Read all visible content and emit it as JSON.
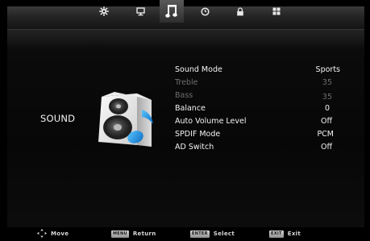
{
  "tabs": [
    {
      "icon": "gear-icon"
    },
    {
      "icon": "monitor-icon"
    },
    {
      "icon": "music-note-icon",
      "active": true
    },
    {
      "icon": "clock-icon"
    },
    {
      "icon": "lock-icon"
    },
    {
      "icon": "grid-icon"
    }
  ],
  "category": {
    "label": "SOUND",
    "icon": "speaker-icon"
  },
  "settings": [
    {
      "label": "Sound Mode",
      "value": "Sports",
      "state": "bright"
    },
    {
      "label": "Treble",
      "value": "35",
      "state": "dim"
    },
    {
      "label": "Bass",
      "value": "35",
      "state": "dim"
    },
    {
      "label": "Balance",
      "value": "0",
      "state": "bright"
    },
    {
      "label": "Auto Volume Level",
      "value": "Off",
      "state": "bright"
    },
    {
      "label": "SPDIF Mode",
      "value": "PCM",
      "state": "bright"
    },
    {
      "label": "AD Switch",
      "value": "Off",
      "state": "bright"
    }
  ],
  "hints": {
    "move": {
      "label": "Move",
      "icon": "dpad-icon"
    },
    "return": {
      "key": "MENU",
      "label": "Return"
    },
    "select": {
      "key": "ENTER",
      "label": "Select"
    },
    "exit": {
      "key": "EXIT",
      "label": "Exit"
    }
  },
  "colors": {
    "accent_blue": "#1e8fe0",
    "text_bright": "#f4f4f4",
    "text_dim": "#6e6e6e"
  }
}
